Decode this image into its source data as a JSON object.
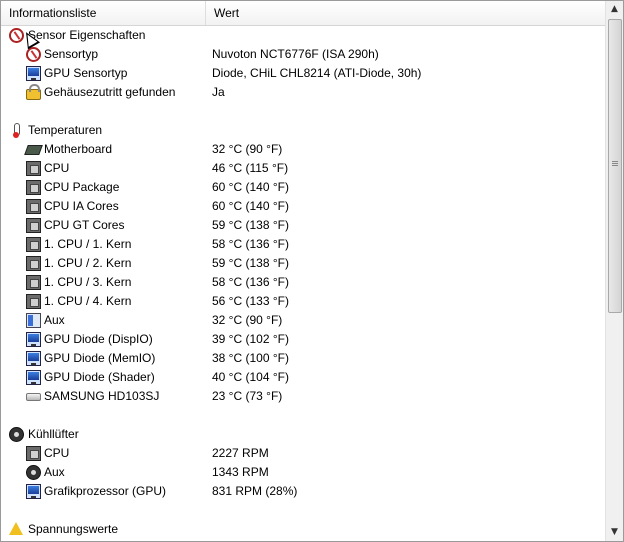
{
  "header": {
    "col1": "Informationsliste",
    "col2": "Wert"
  },
  "rows": [
    {
      "type": "group",
      "icon": "sensor-icon",
      "label": "Sensor Eigenschaften",
      "value": ""
    },
    {
      "type": "item",
      "icon": "sensor-icon",
      "label": "Sensortyp",
      "value": "Nuvoton NCT6776F  (ISA 290h)"
    },
    {
      "type": "item",
      "icon": "monitor-icon",
      "label": "GPU Sensortyp",
      "value": "Diode, CHiL CHL8214  (ATI-Diode, 30h)"
    },
    {
      "type": "item",
      "icon": "lock-icon",
      "label": "Gehäusezutritt gefunden",
      "value": "Ja"
    },
    {
      "type": "spacer"
    },
    {
      "type": "group",
      "icon": "thermometer-icon",
      "label": "Temperaturen",
      "value": ""
    },
    {
      "type": "item",
      "icon": "motherboard-icon",
      "label": "Motherboard",
      "value": "32 °C  (90 °F)"
    },
    {
      "type": "item",
      "icon": "cpu-icon",
      "label": "CPU",
      "value": "46 °C  (115 °F)"
    },
    {
      "type": "item",
      "icon": "cpu-icon",
      "label": "CPU Package",
      "value": "60 °C  (140 °F)"
    },
    {
      "type": "item",
      "icon": "cpu-icon",
      "label": "CPU IA Cores",
      "value": "60 °C  (140 °F)"
    },
    {
      "type": "item",
      "icon": "cpu-icon",
      "label": "CPU GT Cores",
      "value": "59 °C  (138 °F)"
    },
    {
      "type": "item",
      "icon": "cpu-icon",
      "label": "1. CPU / 1. Kern",
      "value": "58 °C  (136 °F)"
    },
    {
      "type": "item",
      "icon": "cpu-icon",
      "label": "1. CPU / 2. Kern",
      "value": "59 °C  (138 °F)"
    },
    {
      "type": "item",
      "icon": "cpu-icon",
      "label": "1. CPU / 3. Kern",
      "value": "58 °C  (136 °F)"
    },
    {
      "type": "item",
      "icon": "cpu-icon",
      "label": "1. CPU / 4. Kern",
      "value": "56 °C  (133 °F)"
    },
    {
      "type": "item",
      "icon": "aux-icon",
      "label": "Aux",
      "value": "32 °C  (90 °F)"
    },
    {
      "type": "item",
      "icon": "monitor-icon",
      "label": "GPU Diode (DispIO)",
      "value": "39 °C  (102 °F)"
    },
    {
      "type": "item",
      "icon": "monitor-icon",
      "label": "GPU Diode (MemIO)",
      "value": "38 °C  (100 °F)"
    },
    {
      "type": "item",
      "icon": "monitor-icon",
      "label": "GPU Diode (Shader)",
      "value": "40 °C  (104 °F)"
    },
    {
      "type": "item",
      "icon": "disk-icon",
      "label": "SAMSUNG HD103SJ",
      "value": "23 °C  (73 °F)"
    },
    {
      "type": "spacer"
    },
    {
      "type": "group",
      "icon": "fan-icon",
      "label": "Kühllüfter",
      "value": ""
    },
    {
      "type": "item",
      "icon": "cpu-icon",
      "label": "CPU",
      "value": "2227 RPM"
    },
    {
      "type": "item",
      "icon": "fan-icon",
      "label": "Aux",
      "value": "1343 RPM"
    },
    {
      "type": "item",
      "icon": "monitor-icon",
      "label": "Grafikprozessor (GPU)",
      "value": "831 RPM  (28%)"
    },
    {
      "type": "spacer"
    },
    {
      "type": "group",
      "icon": "warning-icon",
      "label": "Spannungswerte",
      "value": ""
    }
  ],
  "scrollbar": {
    "up_glyph": "▲",
    "down_glyph": "▼"
  }
}
